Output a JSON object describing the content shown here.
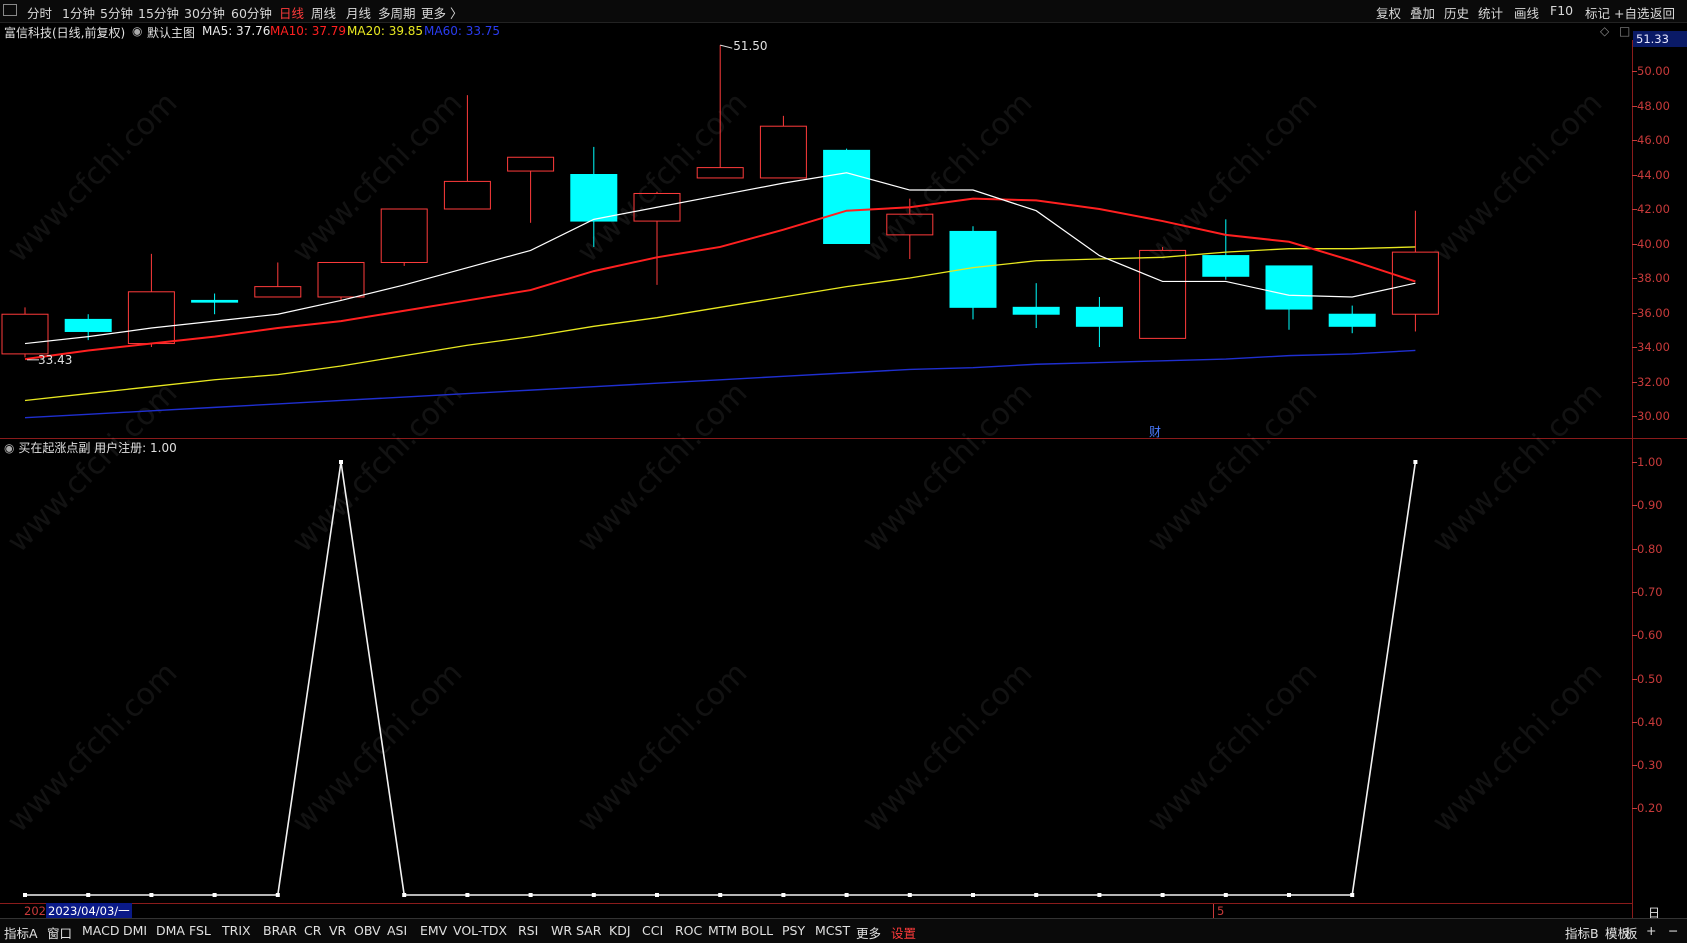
{
  "toolbar": {
    "left_items": [
      "分时",
      "1分钟",
      "5分钟",
      "15分钟",
      "30分钟",
      "60分钟",
      "日线",
      "周线",
      "月线",
      "多周期",
      "更多 〉"
    ],
    "active_item": "日线",
    "right_items": [
      "复权",
      "叠加",
      "历史",
      "统计",
      "画线",
      "F10",
      "标记",
      "+自选",
      "返回"
    ]
  },
  "info": {
    "stock": "富信科技(日线,前复权)",
    "main_chart": "默认主图",
    "ma5": "MA5: 37.76",
    "ma10": "MA10: 37.79",
    "ma20": "MA20: 39.85",
    "ma60": "MA60: 33.75",
    "price_badge": "51.33",
    "high_label": "51.50",
    "low_label": "33.43"
  },
  "colors": {
    "up": "#ff3b3b",
    "down": "#00ffff",
    "ma5": "#ffffff",
    "ma10": "#ff2020",
    "ma20": "#e8e820",
    "ma60": "#1f2fd0",
    "axis": "#c83a3a"
  },
  "main_axis": [
    "50.00",
    "48.00",
    "46.00",
    "44.00",
    "42.00",
    "40.00",
    "38.00",
    "36.00",
    "34.00",
    "32.00",
    "30.00"
  ],
  "sub_axis": [
    "1.00",
    "0.90",
    "0.80",
    "0.70",
    "0.60",
    "0.50",
    "0.40",
    "0.30",
    "0.20"
  ],
  "sub_indicator": {
    "name": "买在起涨点副",
    "label": "用户注册: 1.00"
  },
  "finance_marker": "财",
  "date_label": "2023/04/03/一",
  "date_prefix": "202",
  "month_marker": "5",
  "bottom": {
    "left_items": [
      "指标A",
      "窗口",
      "MACD",
      "DMI",
      "DMA",
      "FSL",
      "TRIX",
      "BRAR",
      "CR",
      "VR",
      "OBV",
      "ASI",
      "EMV",
      "VOL-TDX",
      "RSI",
      "WR",
      "SAR",
      "KDJ",
      "CCI",
      "ROC",
      "MTM",
      "BOLL",
      "PSY",
      "MCST",
      "更多",
      "设置"
    ],
    "right_items": [
      "指标B",
      "模板",
      "板",
      "+",
      "−"
    ],
    "period_label": "日线"
  },
  "watermark_text": "www.cfchi.com",
  "chart_data": {
    "type": "candlestick",
    "candles": [
      {
        "o": 33.6,
        "c": 35.9,
        "h": 36.3,
        "l": 33.4
      },
      {
        "o": 35.6,
        "c": 34.9,
        "h": 35.9,
        "l": 34.4
      },
      {
        "o": 34.2,
        "c": 37.2,
        "h": 39.4,
        "l": 34.0
      },
      {
        "o": 36.7,
        "c": 36.6,
        "h": 37.1,
        "l": 35.9
      },
      {
        "o": 36.9,
        "c": 37.5,
        "h": 38.9,
        "l": 36.9
      },
      {
        "o": 36.9,
        "c": 38.9,
        "h": 38.9,
        "l": 36.7
      },
      {
        "o": 38.9,
        "c": 42.0,
        "h": 42.0,
        "l": 38.7
      },
      {
        "o": 42.0,
        "c": 43.6,
        "h": 48.6,
        "l": 42.0
      },
      {
        "o": 44.2,
        "c": 45.0,
        "h": 45.0,
        "l": 41.2
      },
      {
        "o": 44.0,
        "c": 41.3,
        "h": 45.6,
        "l": 39.8
      },
      {
        "o": 41.3,
        "c": 42.9,
        "h": 43.0,
        "l": 37.6
      },
      {
        "o": 43.8,
        "c": 44.4,
        "h": 51.5,
        "l": 43.8
      },
      {
        "o": 43.8,
        "c": 46.8,
        "h": 47.4,
        "l": 43.8
      },
      {
        "o": 45.4,
        "c": 40.0,
        "h": 45.5,
        "l": 40.0
      },
      {
        "o": 40.5,
        "c": 41.7,
        "h": 42.6,
        "l": 39.1
      },
      {
        "o": 40.7,
        "c": 36.3,
        "h": 41.0,
        "l": 35.6
      },
      {
        "o": 36.3,
        "c": 35.9,
        "h": 37.7,
        "l": 35.1
      },
      {
        "o": 36.3,
        "c": 35.2,
        "h": 36.9,
        "l": 34.0
      },
      {
        "o": 34.5,
        "c": 39.6,
        "h": 39.8,
        "l": 34.5
      },
      {
        "o": 39.3,
        "c": 38.1,
        "h": 41.4,
        "l": 37.9
      },
      {
        "o": 38.7,
        "c": 36.2,
        "h": 38.7,
        "l": 35.0
      },
      {
        "o": 35.9,
        "c": 35.2,
        "h": 36.4,
        "l": 34.8
      },
      {
        "o": 35.9,
        "c": 39.5,
        "h": 41.9,
        "l": 34.9
      }
    ],
    "ma5": [
      34.2,
      34.6,
      35.1,
      35.5,
      35.9,
      36.7,
      37.6,
      38.6,
      39.6,
      41.4,
      42.1,
      42.8,
      43.5,
      44.1,
      43.1,
      43.1,
      41.9,
      39.3,
      37.8,
      37.8,
      37.0,
      36.9,
      37.7
    ],
    "ma10": [
      33.3,
      33.8,
      34.2,
      34.6,
      35.1,
      35.5,
      36.1,
      36.7,
      37.3,
      38.4,
      39.2,
      39.8,
      40.8,
      41.9,
      42.1,
      42.6,
      42.5,
      42.0,
      41.3,
      40.5,
      40.1,
      39.0,
      37.8
    ],
    "ma20": [
      30.9,
      31.3,
      31.7,
      32.1,
      32.4,
      32.9,
      33.5,
      34.1,
      34.6,
      35.2,
      35.7,
      36.3,
      36.9,
      37.5,
      38.0,
      38.6,
      39.0,
      39.1,
      39.2,
      39.5,
      39.7,
      39.7,
      39.8
    ],
    "ma60": [
      29.9,
      30.1,
      30.3,
      30.5,
      30.7,
      30.9,
      31.1,
      31.3,
      31.5,
      31.7,
      31.9,
      32.1,
      32.3,
      32.5,
      32.7,
      32.8,
      33.0,
      33.1,
      33.2,
      33.3,
      33.5,
      33.6,
      33.8
    ],
    "signal": [
      0,
      0,
      0,
      0,
      0,
      1,
      0,
      0,
      0,
      0,
      0,
      0,
      0,
      0,
      0,
      0,
      0,
      0,
      0,
      0,
      0,
      0,
      1
    ],
    "main_ylim": [
      29,
      53
    ],
    "sub_ylim": [
      0,
      1
    ]
  }
}
